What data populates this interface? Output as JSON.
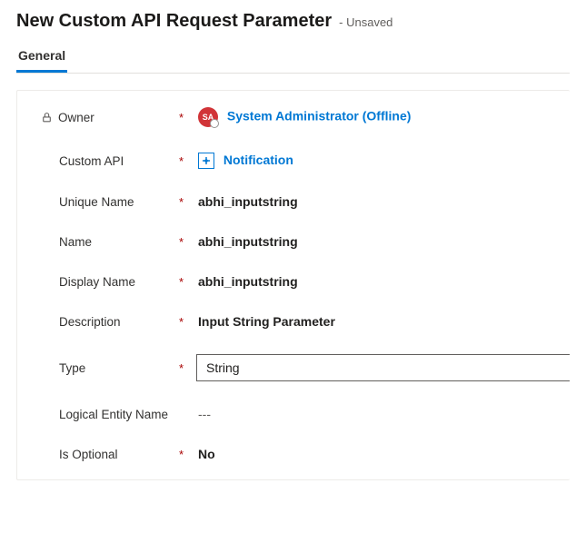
{
  "header": {
    "title": "New Custom API Request Parameter",
    "status_prefix": "- ",
    "status": "Unsaved"
  },
  "tabs": {
    "general": "General"
  },
  "fields": {
    "owner": {
      "label": "Owner",
      "value_name": "System Administrator (Offline)",
      "avatar_initials": "SA",
      "required": "*"
    },
    "custom_api": {
      "label": "Custom API",
      "value": "Notification",
      "required": "*"
    },
    "unique_name": {
      "label": "Unique Name",
      "value": "abhi_inputstring",
      "required": "*"
    },
    "name": {
      "label": "Name",
      "value": "abhi_inputstring",
      "required": "*"
    },
    "display_name": {
      "label": "Display Name",
      "value": "abhi_inputstring",
      "required": "*"
    },
    "description": {
      "label": "Description",
      "value": "Input String Parameter",
      "required": "*"
    },
    "type": {
      "label": "Type",
      "value": "String",
      "required": "*"
    },
    "logical_entity_name": {
      "label": "Logical Entity Name",
      "value": "---"
    },
    "is_optional": {
      "label": "Is Optional",
      "value": "No",
      "required": "*"
    }
  }
}
